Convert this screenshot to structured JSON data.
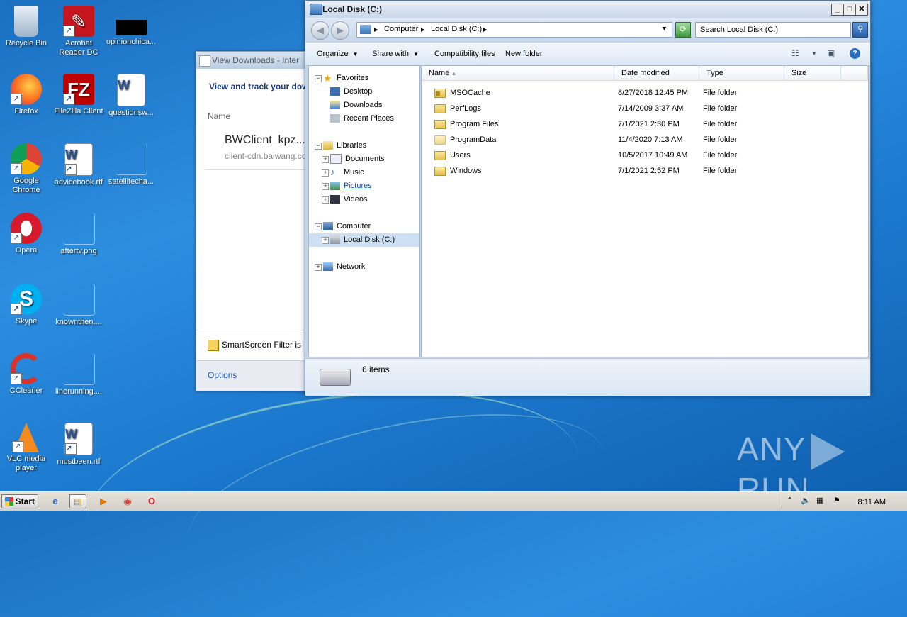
{
  "desktop": {
    "icons": [
      {
        "label": "Recycle Bin"
      },
      {
        "label": "Acrobat Reader DC"
      },
      {
        "label": "opinionchica..."
      },
      {
        "label": "Firefox"
      },
      {
        "label": "FileZilla Client"
      },
      {
        "label": "questionsw..."
      },
      {
        "label": "Google Chrome"
      },
      {
        "label": "advicebook.rtf"
      },
      {
        "label": "satellitecha..."
      },
      {
        "label": "Opera"
      },
      {
        "label": "aftertv.png"
      },
      {
        "label": "Skype"
      },
      {
        "label": "knownthen...."
      },
      {
        "label": "CCleaner"
      },
      {
        "label": "linerunning...."
      },
      {
        "label": "VLC media player"
      },
      {
        "label": "mustbeen.rtf"
      }
    ]
  },
  "downloads_window": {
    "title": "View Downloads - Inter",
    "heading": "View and track your dow",
    "column_name": "Name",
    "file_name": "BWClient_kpz...",
    "file_source": "client-cdn.baiwang.co",
    "smartscreen": "SmartScreen Filter is",
    "options": "Options"
  },
  "explorer": {
    "title": "Local Disk (C:)",
    "address": {
      "crumbs": [
        "Computer",
        "Local Disk (C:)"
      ]
    },
    "search_placeholder": "Search Local Disk (C:)",
    "toolbar": {
      "organize": "Organize",
      "share_with": "Share with",
      "compatibility": "Compatibility files",
      "new_folder": "New folder"
    },
    "nav": {
      "favorites": "Favorites",
      "desktop": "Desktop",
      "downloads": "Downloads",
      "recent": "Recent Places",
      "libraries": "Libraries",
      "documents": "Documents",
      "music": "Music",
      "pictures": "Pictures",
      "videos": "Videos",
      "computer": "Computer",
      "local_disk": "Local Disk (C:)",
      "network": "Network"
    },
    "columns": {
      "name": "Name",
      "date": "Date modified",
      "type": "Type",
      "size": "Size"
    },
    "files": [
      {
        "name": "MSOCache",
        "date": "8/27/2018 12:45 PM",
        "type": "File folder"
      },
      {
        "name": "PerfLogs",
        "date": "7/14/2009 3:37 AM",
        "type": "File folder"
      },
      {
        "name": "Program Files",
        "date": "7/1/2021 2:30 PM",
        "type": "File folder"
      },
      {
        "name": "ProgramData",
        "date": "11/4/2020 7:13 AM",
        "type": "File folder"
      },
      {
        "name": "Users",
        "date": "10/5/2017 10:49 AM",
        "type": "File folder"
      },
      {
        "name": "Windows",
        "date": "7/1/2021 2:52 PM",
        "type": "File folder"
      }
    ],
    "status": "6 items"
  },
  "taskbar": {
    "start": "Start",
    "clock": "8:11 AM"
  },
  "watermark": {
    "left": "ANY",
    "right": "RUN"
  }
}
